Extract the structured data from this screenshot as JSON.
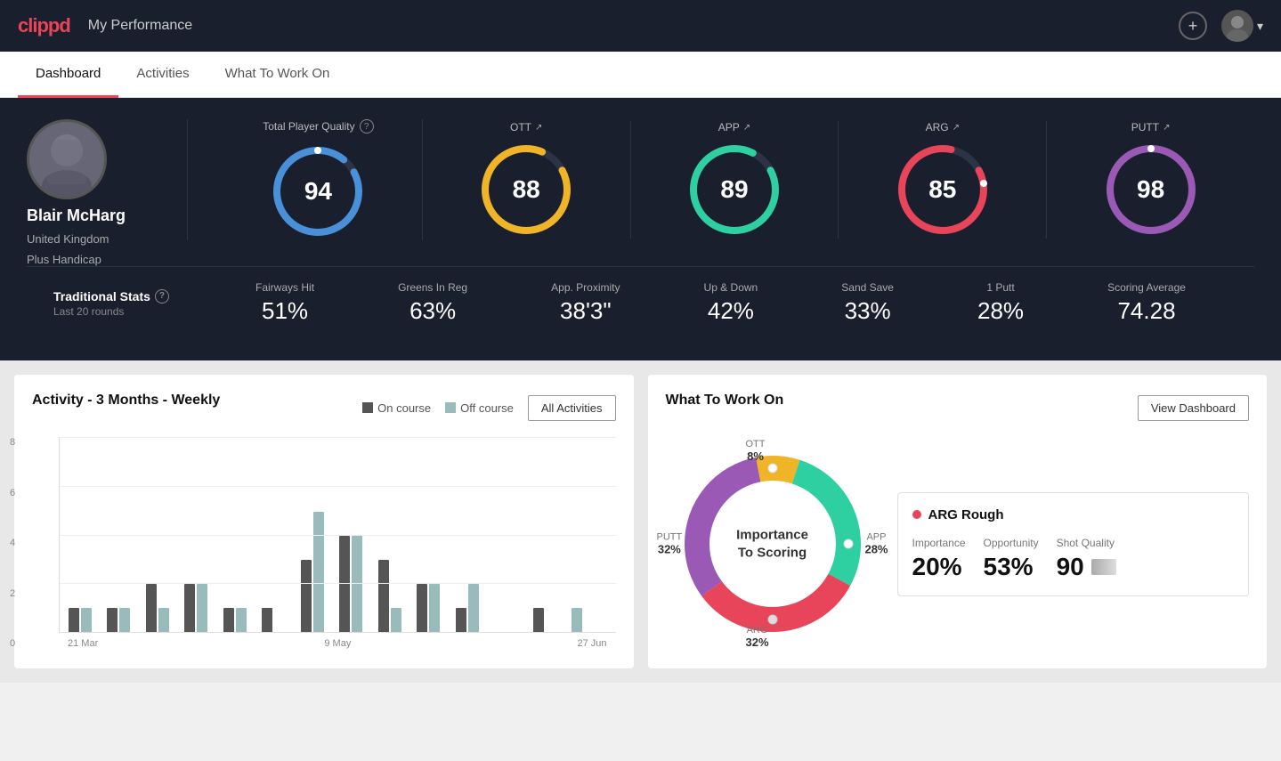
{
  "header": {
    "logo": "clippd",
    "title": "My Performance",
    "add_label": "+",
    "user_chevron": "▾"
  },
  "nav": {
    "tabs": [
      {
        "id": "dashboard",
        "label": "Dashboard",
        "active": true
      },
      {
        "id": "activities",
        "label": "Activities",
        "active": false
      },
      {
        "id": "what-to-work-on",
        "label": "What To Work On",
        "active": false
      }
    ]
  },
  "player": {
    "name": "Blair McHarg",
    "country": "United Kingdom",
    "handicap": "Plus Handicap"
  },
  "total_quality": {
    "title": "Total Player Quality",
    "score": 94,
    "color": "#4a90d9"
  },
  "scores": [
    {
      "label": "OTT",
      "value": 88,
      "color": "#f0b429",
      "bg": "#1a1f2e"
    },
    {
      "label": "APP",
      "value": 89,
      "color": "#2ecfa0",
      "bg": "#1a1f2e"
    },
    {
      "label": "ARG",
      "value": 85,
      "color": "#e8445a",
      "bg": "#1a1f2e"
    },
    {
      "label": "PUTT",
      "value": 98,
      "color": "#9b59b6",
      "bg": "#1a1f2e"
    }
  ],
  "trad_stats": {
    "title": "Traditional Stats",
    "subtitle": "Last 20 rounds",
    "items": [
      {
        "label": "Fairways Hit",
        "value": "51%"
      },
      {
        "label": "Greens In Reg",
        "value": "63%"
      },
      {
        "label": "App. Proximity",
        "value": "38'3\""
      },
      {
        "label": "Up & Down",
        "value": "42%"
      },
      {
        "label": "Sand Save",
        "value": "33%"
      },
      {
        "label": "1 Putt",
        "value": "28%"
      },
      {
        "label": "Scoring Average",
        "value": "74.28"
      }
    ]
  },
  "activity_chart": {
    "title": "Activity - 3 Months - Weekly",
    "legend": [
      {
        "label": "On course",
        "color": "#555"
      },
      {
        "label": "Off course",
        "color": "#9bb"
      }
    ],
    "all_activities_btn": "All Activities",
    "y_labels": [
      "8",
      "6",
      "4",
      "2",
      "0"
    ],
    "x_labels": [
      "21 Mar",
      "9 May",
      "27 Jun"
    ],
    "bars": [
      {
        "on": 1,
        "off": 1
      },
      {
        "on": 1,
        "off": 1
      },
      {
        "on": 2,
        "off": 1
      },
      {
        "on": 2,
        "off": 2
      },
      {
        "on": 1,
        "off": 1
      },
      {
        "on": 1,
        "off": 0
      },
      {
        "on": 3,
        "off": 5
      },
      {
        "on": 4,
        "off": 4
      },
      {
        "on": 3,
        "off": 1
      },
      {
        "on": 2,
        "off": 2
      },
      {
        "on": 1,
        "off": 2
      },
      {
        "on": 0,
        "off": 0
      },
      {
        "on": 1,
        "off": 0
      },
      {
        "on": 0,
        "off": 1
      }
    ]
  },
  "what_to_work_on": {
    "title": "What To Work On",
    "view_dashboard_btn": "View Dashboard",
    "donut_center": "Importance\nTo Scoring",
    "segments": [
      {
        "label": "OTT",
        "value": "8%",
        "color": "#f0b429"
      },
      {
        "label": "APP",
        "value": "28%",
        "color": "#2ecfa0"
      },
      {
        "label": "ARG",
        "value": "32%",
        "color": "#e8445a"
      },
      {
        "label": "PUTT",
        "value": "32%",
        "color": "#9b59b6"
      }
    ],
    "detail": {
      "title": "ARG Rough",
      "dot_color": "#e8445a",
      "metrics": [
        {
          "label": "Importance",
          "value": "20%"
        },
        {
          "label": "Opportunity",
          "value": "53%"
        },
        {
          "label": "Shot Quality",
          "value": "90",
          "has_swatch": true
        }
      ]
    }
  }
}
